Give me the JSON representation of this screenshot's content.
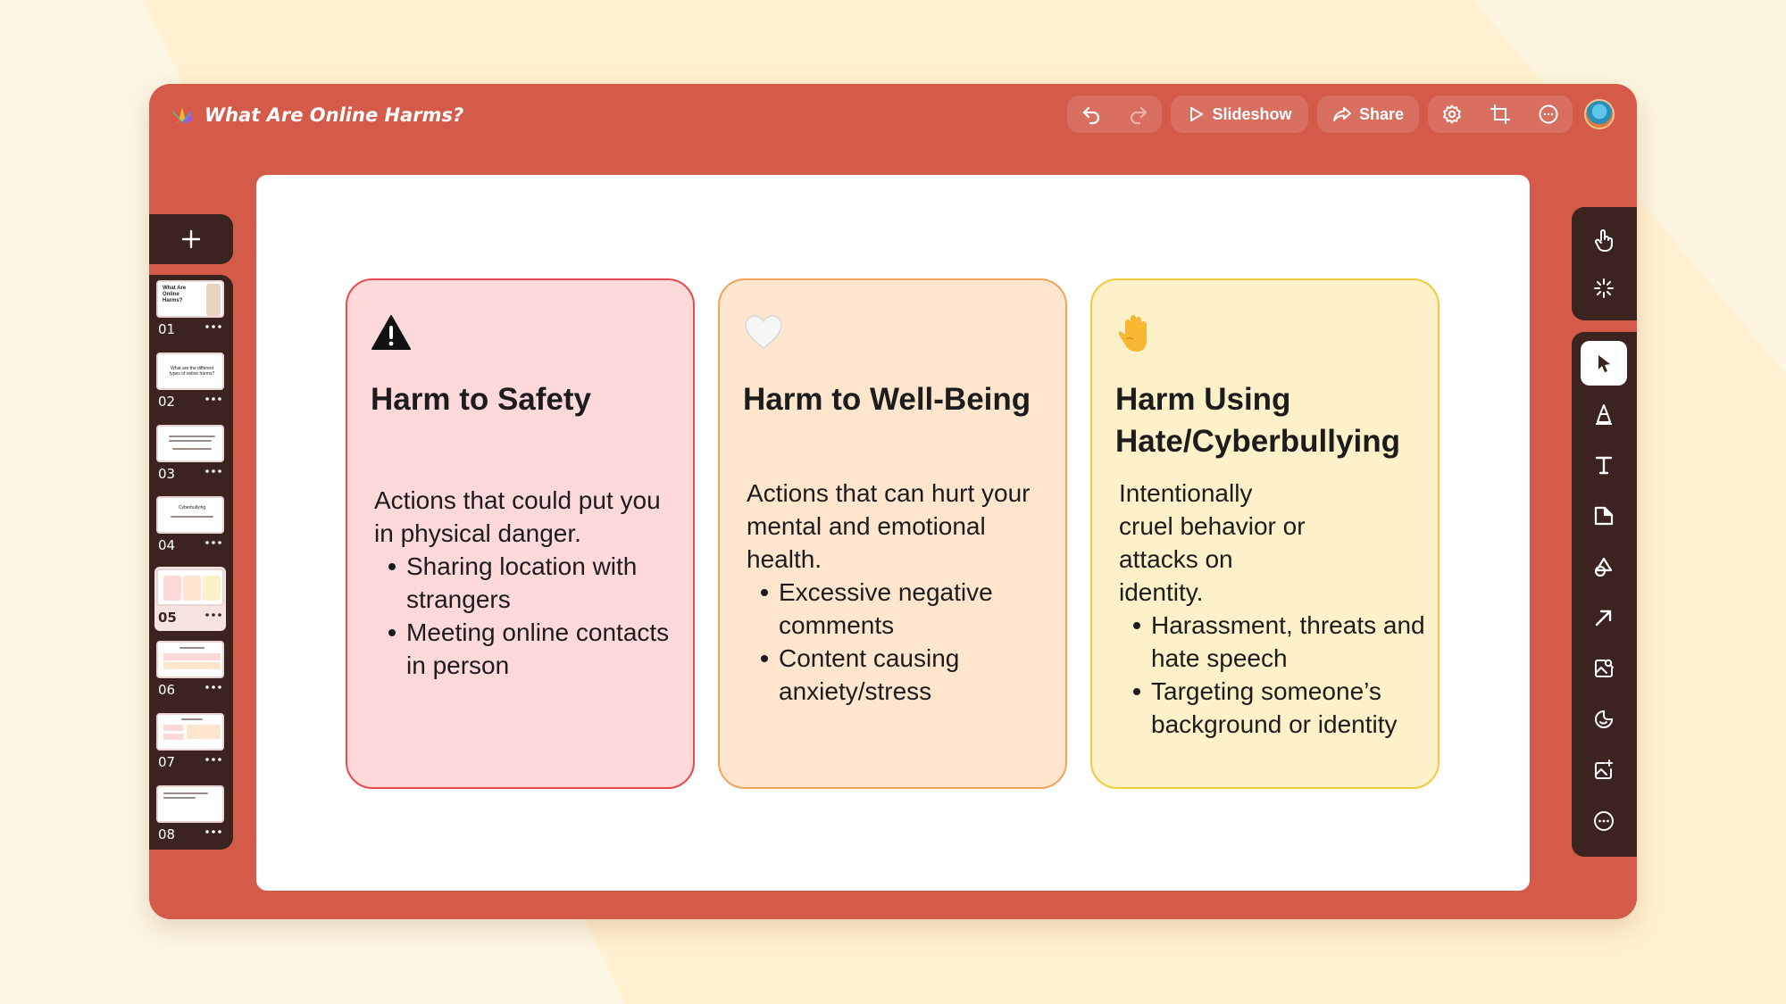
{
  "app": {
    "document_title": "What Are Online Harms?",
    "logo_icon": "app-logo-icon"
  },
  "toolbar": {
    "undo_icon": "undo-icon",
    "redo_icon": "redo-icon",
    "slideshow_label": "Slideshow",
    "share_label": "Share",
    "settings_icon": "gear-icon",
    "resize_icon": "crop-icon",
    "more_icon": "more-icon"
  },
  "slides": [
    {
      "number": "01",
      "active": false,
      "thumb_text": "What Are Online Harms?"
    },
    {
      "number": "02",
      "active": false,
      "thumb_text": "What are the different types of online harms?"
    },
    {
      "number": "03",
      "active": false,
      "thumb_text": ""
    },
    {
      "number": "04",
      "active": false,
      "thumb_text": "Cyberbullying"
    },
    {
      "number": "05",
      "active": true,
      "thumb_text": ""
    },
    {
      "number": "06",
      "active": false,
      "thumb_text": ""
    },
    {
      "number": "07",
      "active": false,
      "thumb_text": ""
    },
    {
      "number": "08",
      "active": false,
      "thumb_text": ""
    }
  ],
  "cards": [
    {
      "icon": "warning-icon",
      "title": "Harm to Safety",
      "intro": "Actions that could put you in physical danger.",
      "bullets": [
        "Sharing location with strangers",
        "Meeting online contacts in person"
      ]
    },
    {
      "icon": "white-heart-icon",
      "title": "Harm to Well-Being",
      "intro": "Actions that can hurt your mental and emotional health.",
      "bullets": [
        "Excessive negative comments",
        "Content causing anxiety/stress"
      ]
    },
    {
      "icon": "raised-hand-icon",
      "title": "Harm Using Hate/Cyberbullying",
      "intro": "Intentionally cruel behavior or attacks on identity.",
      "bullets": [
        "Harassment, threats and hate speech",
        "Targeting someone’s background or identity"
      ]
    }
  ],
  "right_tools": {
    "top": [
      "hand-pointer-icon",
      "sparkle-click-icon"
    ],
    "main": [
      "cursor-icon",
      "highlighter-icon",
      "text-icon",
      "sticky-note-icon",
      "shapes-icon",
      "arrow-icon",
      "image-search-icon",
      "sticker-icon",
      "ai-image-icon",
      "more-tools-icon"
    ]
  },
  "colors": {
    "window": "#d45a4a",
    "dark_panel": "#3b2420",
    "card_safety": "#fdd9da",
    "card_wellbeing": "#fde6cd",
    "card_hate": "#fdf1c9"
  }
}
